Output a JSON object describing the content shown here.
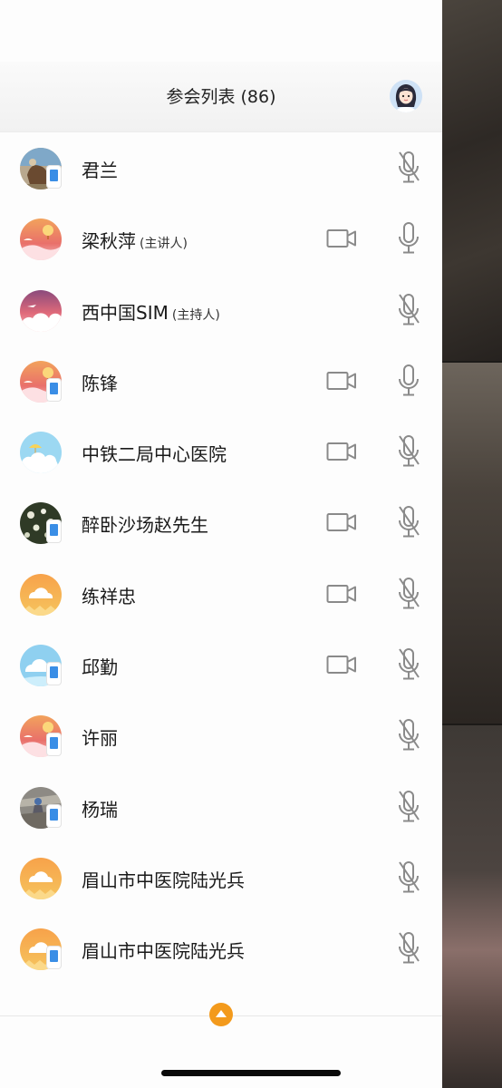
{
  "header": {
    "title": "参会列表 (86)"
  },
  "participants": [
    {
      "name": "君兰",
      "role": "",
      "avatar": "photo-horse",
      "device": "phone",
      "camera": false,
      "mic": "muted"
    },
    {
      "name": "梁秋萍",
      "role": "(主讲人)",
      "avatar": "sunset-balloon",
      "device": "",
      "camera": true,
      "mic": "on"
    },
    {
      "name": "西中国SIM",
      "role": "(主持人)",
      "avatar": "pink-cloud-plane",
      "device": "",
      "camera": false,
      "mic": "muted"
    },
    {
      "name": "陈锋",
      "role": "",
      "avatar": "sunset-balloon",
      "device": "phone",
      "camera": true,
      "mic": "on"
    },
    {
      "name": "中铁二局中心医院",
      "role": "",
      "avatar": "sky-umbrella",
      "device": "",
      "camera": true,
      "mic": "muted"
    },
    {
      "name": "醉卧沙场赵先生",
      "role": "",
      "avatar": "photo-flowers",
      "device": "phone",
      "camera": true,
      "mic": "muted"
    },
    {
      "name": "练祥忠",
      "role": "",
      "avatar": "orange-cloud",
      "device": "",
      "camera": true,
      "mic": "muted"
    },
    {
      "name": "邱勤",
      "role": "",
      "avatar": "blue-cloud",
      "device": "phone",
      "camera": true,
      "mic": "muted"
    },
    {
      "name": "许丽",
      "role": "",
      "avatar": "sunset-balloon",
      "device": "phone",
      "camera": false,
      "mic": "muted"
    },
    {
      "name": "杨瑞",
      "role": "",
      "avatar": "photo-rocks",
      "device": "phone",
      "camera": false,
      "mic": "muted"
    },
    {
      "name": "眉山市中医院陆光兵",
      "role": "",
      "avatar": "orange-cloud",
      "device": "",
      "camera": false,
      "mic": "muted"
    },
    {
      "name": "眉山市中医院陆光兵",
      "role": "",
      "avatar": "orange-cloud",
      "device": "phone",
      "camera": false,
      "mic": "muted"
    }
  ],
  "icons": {
    "camera": "video-camera-icon",
    "mic_on": "microphone-icon",
    "mic_muted": "microphone-muted-icon",
    "collapse": "chevron-up-icon"
  },
  "colors": {
    "accent": "#f39a1c",
    "icon_gray": "#8a8a8a",
    "phone_badge": "#3a8ee6"
  }
}
